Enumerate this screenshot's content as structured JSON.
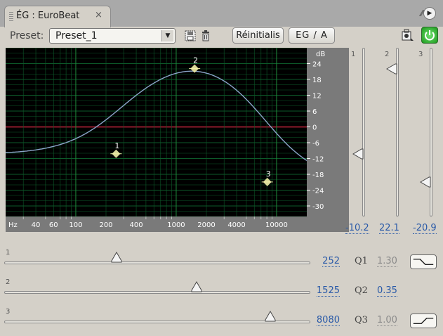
{
  "tab": {
    "title": "ÉG : EuroBeat",
    "close": "×"
  },
  "toolbar": {
    "preset_label": "Preset:",
    "preset_value": "Preset_1",
    "reset_label": "Réinitialis",
    "ega_label": "EG / A"
  },
  "graph": {
    "db_unit": "dB",
    "db_ticks": [
      "24",
      "18",
      "12",
      "6",
      "0",
      "-6",
      "-12",
      "-18",
      "-24",
      "-30"
    ],
    "hz_unit": "Hz",
    "hz_ticks": [
      "40",
      "60",
      "100",
      "200",
      "400",
      "1000",
      "2000",
      "4000",
      "10000"
    ],
    "points": [
      "1",
      "2",
      "3"
    ],
    "curve_color": "#8aa4c8",
    "zero_line_color": "#8a1a2a",
    "grid_color": "#0d5a2a"
  },
  "bands": [
    {
      "number": "1",
      "gain": "-10.2",
      "gain_db": -10.2,
      "freq": "252",
      "q_label": "Q1",
      "q": "1.30",
      "q_enabled": false,
      "shape": "low-shelf-icon"
    },
    {
      "number": "2",
      "gain": "22.1",
      "gain_db": 22.1,
      "freq": "1525",
      "q_label": "Q2",
      "q": "0.35",
      "q_enabled": true,
      "shape": ""
    },
    {
      "number": "3",
      "gain": "-20.9",
      "gain_db": -20.9,
      "freq": "8080",
      "q_label": "Q3",
      "q": "1.00",
      "q_enabled": false,
      "shape": "high-shelf-icon"
    }
  ]
}
